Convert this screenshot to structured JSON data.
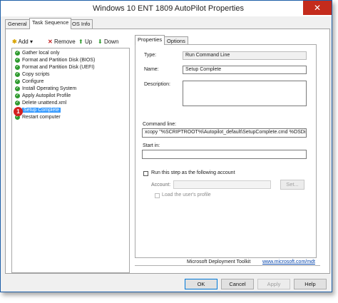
{
  "window": {
    "title": "Windows 10 ENT 1809 AutoPilot Properties",
    "close_glyph": "✕"
  },
  "tabs": [
    "General",
    "Task Sequence",
    "OS Info"
  ],
  "toolbar": {
    "add": "Add",
    "remove": "Remove",
    "up": "Up",
    "down": "Down"
  },
  "tree": {
    "items": [
      "Gather local only",
      "Format and Partition Disk (BIOS)",
      "Format and Partition Disk (UEFI)",
      "Copy scripts",
      "Configure",
      "Install Operating System",
      "Apply Autopilot Profile",
      "Delete unattend.xml",
      "Setup Complete",
      "Restart computer"
    ],
    "selected_index": 8,
    "badge": "1"
  },
  "inner_tabs": [
    "Properties",
    "Options"
  ],
  "properties": {
    "type_label": "Type:",
    "type_value": "Run Command Line",
    "name_label": "Name:",
    "name_value": "Setup Complete",
    "description_label": "Description:",
    "description_value": "",
    "command_line_label": "Command line:",
    "command_line_value": "xcopy \"%SCRIPTROOT%\\Autopilot_default\\SetupComplete.cmd %OSDisk%",
    "start_in_label": "Start in:",
    "start_in_value": "",
    "run_as_label": "Run this step as the following account",
    "account_label": "Account:",
    "account_value": "",
    "set_button": "Set...",
    "load_profile_label": "Load the user's profile"
  },
  "footer": {
    "toolkit": "Microsoft Deployment Toolkit",
    "link": "www.microsoft.com/mdt",
    "ok": "OK",
    "cancel": "Cancel",
    "apply": "Apply",
    "help": "Help"
  },
  "colors": {
    "selection": "#3399ff",
    "check_green": "#2e9a2e",
    "badge_red": "#d42020",
    "close_red": "#c42b1c",
    "frame_blue": "#1e5fa8"
  },
  "icons": [
    "add-icon",
    "remove-icon",
    "up-icon",
    "down-icon",
    "check-icon"
  ]
}
